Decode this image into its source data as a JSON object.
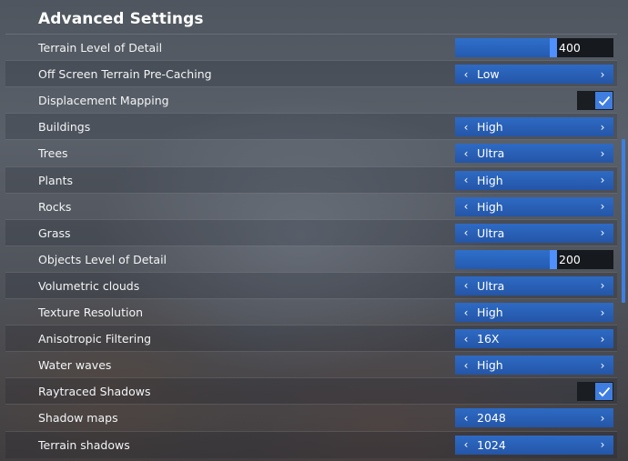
{
  "title": "Advanced Settings",
  "colors": {
    "accent": "#2f6fcb",
    "knob": "#4f8fff",
    "checkbox": "#3f7ee0",
    "track": "#16191e"
  },
  "rows": [
    {
      "label": "Terrain Level of Detail",
      "type": "slider",
      "value": "400",
      "fill_fraction": 0.62
    },
    {
      "label": "Off Screen Terrain Pre-Caching",
      "type": "select",
      "value": "Low"
    },
    {
      "label": "Displacement Mapping",
      "type": "checkbox",
      "checked": true
    },
    {
      "label": "Buildings",
      "type": "select",
      "value": "High"
    },
    {
      "label": "Trees",
      "type": "select",
      "value": "Ultra"
    },
    {
      "label": "Plants",
      "type": "select",
      "value": "High"
    },
    {
      "label": "Rocks",
      "type": "select",
      "value": "High"
    },
    {
      "label": "Grass",
      "type": "select",
      "value": "Ultra"
    },
    {
      "label": "Objects Level of Detail",
      "type": "slider",
      "value": "200",
      "fill_fraction": 0.62
    },
    {
      "label": "Volumetric clouds",
      "type": "select",
      "value": "Ultra"
    },
    {
      "label": "Texture Resolution",
      "type": "select",
      "value": "High"
    },
    {
      "label": "Anisotropic Filtering",
      "type": "select",
      "value": "16X"
    },
    {
      "label": "Water waves",
      "type": "select",
      "value": "High"
    },
    {
      "label": "Raytraced Shadows",
      "type": "checkbox",
      "checked": true
    },
    {
      "label": "Shadow maps",
      "type": "select",
      "value": "2048"
    },
    {
      "label": "Terrain shadows",
      "type": "select",
      "value": "1024"
    }
  ]
}
